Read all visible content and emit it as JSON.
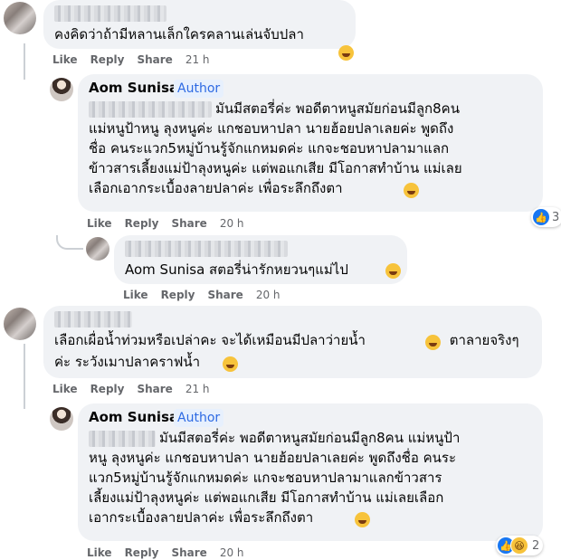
{
  "actions": {
    "like": "Like",
    "reply": "Reply",
    "share": "Share"
  },
  "comments": [
    {
      "text": "คงคิดว่าถ้ามีหลานเล็กใครคลานเล่นจับปลา",
      "time": "21 h"
    },
    {
      "name": "Aom Sunisa",
      "badge": "Author",
      "lines": [
        "มันมีสตอรี่ค่ะ พอดีตาหนูสมัยก่อนมีลูก8คน",
        "แม่หนูป้าหนู ลุงหนูค่ะ แกชอบหาปลา นายฮ้อยปลาเลยค่ะ พูดถึง",
        "ชื่อ คนระแวก5หมู่บ้านรู้จักแกหมดค่ะ แกจะชอบหาปลามาแลก",
        "ข้าวสารเลี้ยงแม่ป้าลุงหนูค่ะ แต่พอแกเสีย มีโอกาสทำบ้าน แม่เลย",
        "เลือกเอากระเบื้องลายปลาค่ะ เพื่อระลึกถึงตา"
      ],
      "time": "20 h",
      "reaction_count": "3"
    },
    {
      "text": "Aom Sunisa สตอรี่น่ารักหยวนๆแม่ไป",
      "time": "20 h"
    },
    {
      "lines": [
        "เลือกเผื่อน้ำท่วมหรือเปล่าคะ จะได้เหมือนมีปลาว่ายน้ำ",
        " ตาลายจริงๆ",
        "ค่ะ ระวังเมาปลาคราฟน้ำ"
      ],
      "time": "21 h"
    },
    {
      "name": "Aom Sunisa",
      "badge": "Author",
      "lines": [
        "มันมีสตอรี่ค่ะ พอดีตาหนูสมัยก่อนมีลูก8คน แม่หนูป้า",
        "หนู ลุงหนูค่ะ แกชอบหาปลา นายฮ้อยปลาเลยค่ะ พูดถึงชื่อ คนระ",
        "แวก5หมู่บ้านรู้จักแกหมดค่ะ แกจะชอบหาปลามาแลกข้าวสาร",
        "เลี้ยงแม่ป้าลุงหนูค่ะ แต่พอแกเสีย มีโอกาสทำบ้าน แม่เลยเลือก",
        "เอากระเบื้องลายปลาค่ะ เพื่อระลึกถึงตา"
      ],
      "time": "20 h",
      "reaction_count": "2"
    }
  ]
}
